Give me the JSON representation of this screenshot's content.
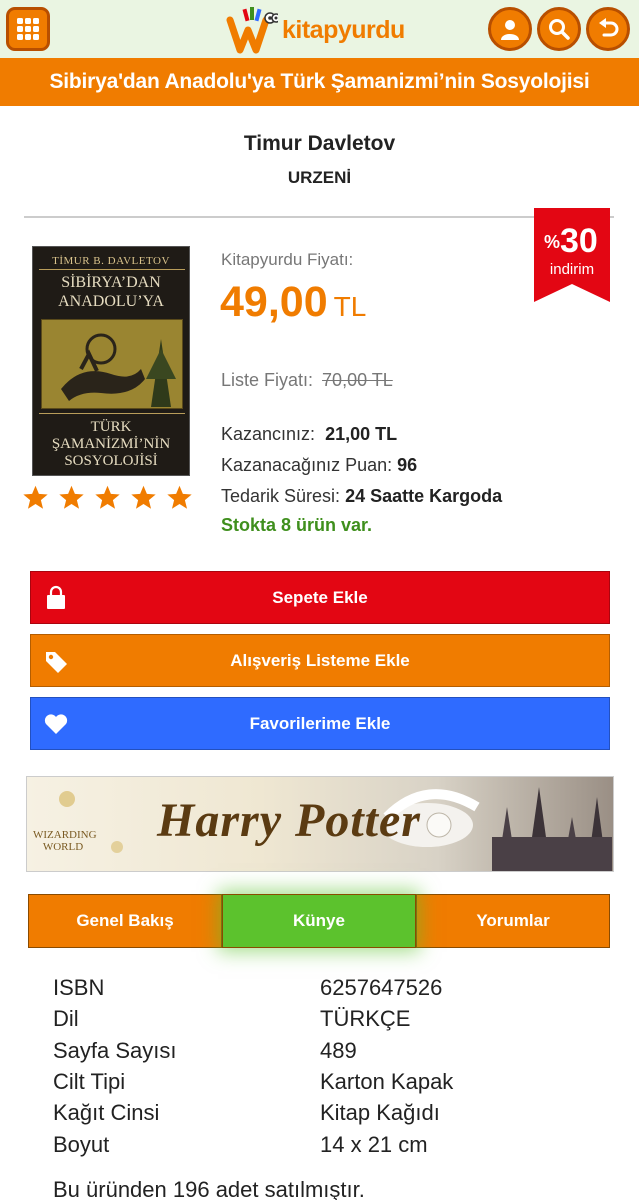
{
  "header": {
    "logo_text": "kitapyurdu",
    "title": "Sibirya'dan Anadolu'ya Türk Şamanizmi’nin Sosyolojisi"
  },
  "product": {
    "author": "Timur Davletov",
    "publisher": "URZENİ",
    "discount_number": "30",
    "discount_percent_sign": "%",
    "discount_label": "indirim",
    "cover": {
      "author": "TİMUR B. DAVLETOV",
      "title_top": "SİBİRYA’DAN\nANADOLU’YA",
      "title_bottom": "TÜRK\nŞAMANİZMİ’NİN\nSOSYOLOJİSİ"
    },
    "rating_stars": 5,
    "price_label": "Kitapyurdu Fiyatı:",
    "price": "49,00",
    "currency": "TL",
    "list_price_label": "Liste Fiyatı:",
    "list_price": "70,00 TL",
    "savings_label": "Kazancınız:",
    "savings": "21,00 TL",
    "points_label": "Kazanacağınız Puan:",
    "points": "96",
    "supply_label": "Tedarik Süresi:",
    "supply": "24 Saatte Kargoda",
    "stock": "Stokta 8 ürün var."
  },
  "actions": {
    "cart": "Sepete Ekle",
    "list": "Alışveriş Listeme Ekle",
    "fav": "Favorilerime Ekle"
  },
  "banner": {
    "title": "Harry Potter",
    "sub": "WIZARDING WORLD"
  },
  "tabs": [
    "Genel Bakış",
    "Künye",
    "Yorumlar"
  ],
  "details": [
    {
      "label": "ISBN",
      "value": "6257647526"
    },
    {
      "label": "Dil",
      "value": "TÜRKÇE"
    },
    {
      "label": "Sayfa Sayısı",
      "value": "489"
    },
    {
      "label": "Cilt Tipi",
      "value": "Karton Kapak"
    },
    {
      "label": "Kağıt Cinsi",
      "value": "Kitap Kağıdı"
    },
    {
      "label": "Boyut",
      "value": "14 x 21 cm"
    }
  ],
  "sold_text": "Bu üründen 196 adet satılmıştır.",
  "colors": {
    "brand_orange": "#f07c00",
    "cart_red": "#e30613",
    "fav_blue": "#2f6bff",
    "active_tab_green": "#5cc22d",
    "stock_green": "#3f8f1d"
  }
}
